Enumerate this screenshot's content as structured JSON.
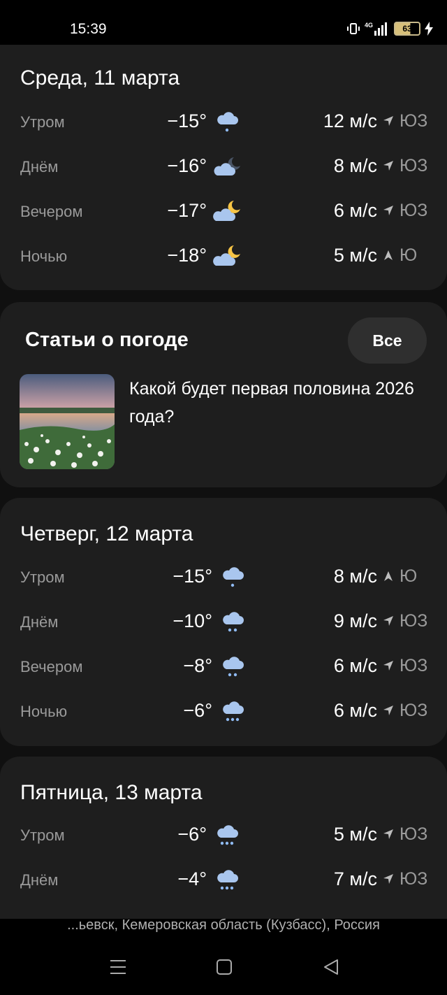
{
  "status_bar": {
    "time": "15:39",
    "battery": "63"
  },
  "days": [
    {
      "title": "Среда, 11 марта",
      "rows": [
        {
          "part": "Утром",
          "temp": "−15°",
          "icon": "cloud-snow-1-icon",
          "wind": "12 м/с",
          "arrow": "sw-arrow-icon",
          "dir": "ЮЗ"
        },
        {
          "part": "Днём",
          "temp": "−16°",
          "icon": "cloud-moon-dark-icon",
          "wind": "8 м/с",
          "arrow": "sw-arrow-icon",
          "dir": "ЮЗ"
        },
        {
          "part": "Вечером",
          "temp": "−17°",
          "icon": "cloud-moon-icon",
          "wind": "6 м/с",
          "arrow": "sw-arrow-icon",
          "dir": "ЮЗ"
        },
        {
          "part": "Ночью",
          "temp": "−18°",
          "icon": "cloud-moon-icon",
          "wind": "5 м/с",
          "arrow": "s-arrow-icon",
          "dir": "Ю"
        }
      ]
    },
    {
      "title": "Четверг, 12 марта",
      "rows": [
        {
          "part": "Утром",
          "temp": "−15°",
          "icon": "cloud-snow-1-icon",
          "wind": "8 м/с",
          "arrow": "s-arrow-icon",
          "dir": "Ю"
        },
        {
          "part": "Днём",
          "temp": "−10°",
          "icon": "cloud-snow-2-icon",
          "wind": "9 м/с",
          "arrow": "sw-arrow-icon",
          "dir": "ЮЗ"
        },
        {
          "part": "Вечером",
          "temp": "−8°",
          "icon": "cloud-snow-2-icon",
          "wind": "6 м/с",
          "arrow": "sw-arrow-icon",
          "dir": "ЮЗ"
        },
        {
          "part": "Ночью",
          "temp": "−6°",
          "icon": "cloud-snow-3-icon",
          "wind": "6 м/с",
          "arrow": "sw-arrow-icon",
          "dir": "ЮЗ"
        }
      ]
    },
    {
      "title": "Пятница, 13 марта",
      "rows": [
        {
          "part": "Утром",
          "temp": "−6°",
          "icon": "cloud-snow-3-icon",
          "wind": "5 м/с",
          "arrow": "sw-arrow-icon",
          "dir": "ЮЗ"
        },
        {
          "part": "Днём",
          "temp": "−4°",
          "icon": "cloud-snow-3-icon",
          "wind": "7 м/с",
          "arrow": "sw-arrow-icon",
          "dir": "ЮЗ"
        }
      ]
    }
  ],
  "articles": {
    "title": "Статьи о погоде",
    "all_label": "Все",
    "items": [
      {
        "text": "Какой будет первая половина 2026 года?"
      }
    ]
  },
  "location": "...ьевск, Кемеровская область (Кузбасс), Россия",
  "colors": {
    "card": "#1e1e1e",
    "secondary_text": "#9a9a9a",
    "cloud": "#a9c6ee",
    "snow": "#8fbaf2",
    "moon": "#f6c445"
  }
}
